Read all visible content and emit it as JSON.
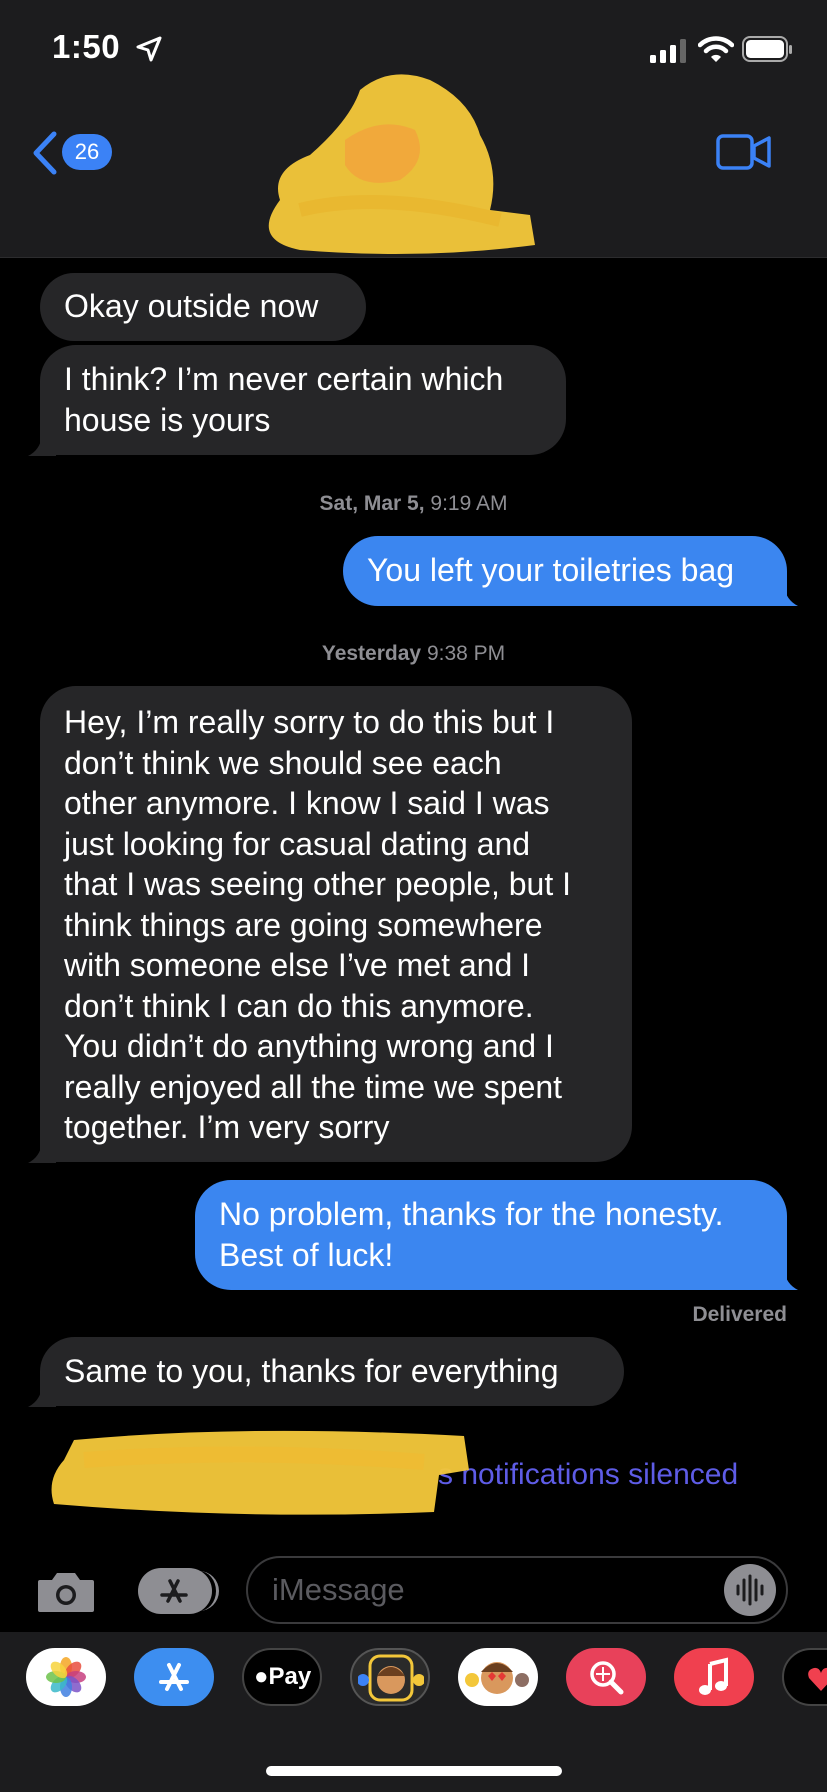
{
  "status_bar": {
    "time": "1:50",
    "location_icon": "location-arrow-icon",
    "signal": "signal-bars-icon",
    "wifi": "wifi-icon",
    "battery": "battery-icon"
  },
  "header": {
    "back_count": "26",
    "back_icon": "chevron-left-icon",
    "video_icon": "video-camera-icon",
    "contact_redacted": true
  },
  "messages": [
    {
      "dir": "in",
      "text_lines": [
        "Okay outside now"
      ]
    },
    {
      "dir": "in",
      "text_lines": [
        "I think? I’m never certain which",
        "house is yours"
      ]
    },
    {
      "type": "stamp",
      "date": "Sat, Mar 5,",
      "time": "9:19 AM"
    },
    {
      "dir": "out",
      "text_lines": [
        "You left your toiletries bag"
      ]
    },
    {
      "type": "stamp",
      "date": "Yesterday",
      "time": "9:38 PM"
    },
    {
      "dir": "in",
      "text_lines": [
        "Hey, I’m really sorry to do this but I",
        "don’t think we should see each",
        "other anymore. I know I said I was",
        "just looking for casual dating and",
        "that I was seeing other people, but I",
        "think things are going somewhere",
        "with someone else I’ve met and I",
        "don’t think I can do this anymore.",
        "You didn’t do anything wrong and I",
        "really enjoyed all the time we spent",
        "together. I’m very sorry"
      ]
    },
    {
      "dir": "out",
      "text_lines": [
        "No problem, thanks for the honesty.",
        "Best of luck!"
      ]
    },
    {
      "type": "delivered",
      "text": "Delivered"
    },
    {
      "dir": "in",
      "text_lines": [
        "Same to you, thanks for everything"
      ]
    }
  ],
  "notice": {
    "text": "s notifications silenced",
    "color": "#5e5ce6"
  },
  "input": {
    "placeholder": "iMessage"
  },
  "dock_apps": [
    {
      "name": "photos-app-icon"
    },
    {
      "name": "app-store-app-icon"
    },
    {
      "name": "apple-pay-app-icon",
      "label": "Pay"
    },
    {
      "name": "memoji-app-icon"
    },
    {
      "name": "animoji-app-icon"
    },
    {
      "name": "image-search-app-icon"
    },
    {
      "name": "music-app-icon"
    },
    {
      "name": "digital-touch-app-icon"
    }
  ],
  "colors": {
    "outgoing": "#3b86f0",
    "incoming": "#262628",
    "accent": "#3b82f6",
    "header_bg": "#1c1c1e"
  }
}
